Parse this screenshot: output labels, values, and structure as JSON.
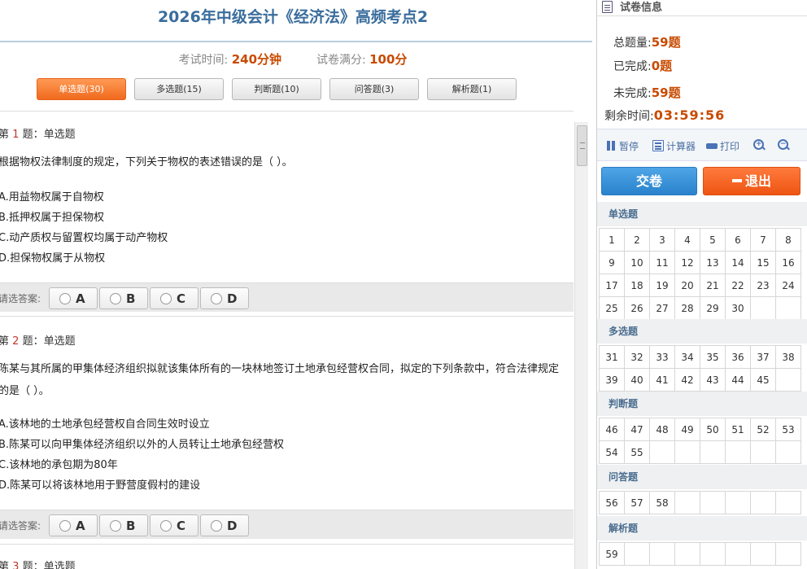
{
  "exam": {
    "title": "2026年中级会计《经济法》高频考点2",
    "time_label": "考试时间:",
    "time_value": "240分钟",
    "score_label": "试卷满分:",
    "score_value": "100分"
  },
  "tabs": [
    {
      "label": "单选题",
      "count": "(30)",
      "active": true
    },
    {
      "label": "多选题",
      "count": "(15)",
      "active": false
    },
    {
      "label": "判断题",
      "count": "(10)",
      "active": false
    },
    {
      "label": "问答题",
      "count": "(3)",
      "active": false
    },
    {
      "label": "解析题",
      "count": "(1)",
      "active": false
    }
  ],
  "questions": [
    {
      "prefix": "第",
      "num": "1",
      "suffix": "题：单选题",
      "text": "根据物权法律制度的规定，下列关于物权的表述错误的是（  ）。",
      "options": [
        "A.用益物权属于自物权",
        "B.抵押权属于担保物权",
        "C.动产质权与留置权均属于动产物权",
        "D.担保物权属于从物权"
      ]
    },
    {
      "prefix": "第",
      "num": "2",
      "suffix": "题：单选题",
      "text": "陈某与其所属的甲集体经济组织拟就该集体所有的一块林地签订土地承包经营权合同，拟定的下列条款中，符合法律规定的是（  ）。",
      "options": [
        "A.该林地的土地承包经营权自合同生效时设立",
        "B.陈某可以向甲集体经济组织以外的人员转让土地承包经营权",
        "C.该林地的承包期为80年",
        "D.陈某可以将该林地用于野营度假村的建设"
      ]
    },
    {
      "prefix": "第",
      "num": "3",
      "suffix": "题：单选题"
    }
  ],
  "answer_label": "请选答案:",
  "answer_choices": [
    "A",
    "B",
    "C",
    "D"
  ],
  "sidebar": {
    "header": "试卷信息",
    "total_label": "总题量:",
    "total_value": "59题",
    "done_label": "已完成:",
    "done_value": "0题",
    "undone_label": "未完成:",
    "undone_value": "59题",
    "timer_label": "剩余时间:",
    "timer_value": "03:59:56",
    "tools": {
      "pause": "暂停",
      "calculator": "计算器",
      "print": "打印"
    },
    "submit": "交卷",
    "exit": "退出",
    "sections": [
      {
        "title": "单选题",
        "rows": [
          [
            "1",
            "2",
            "3",
            "4",
            "5",
            "6",
            "7",
            "8"
          ],
          [
            "9",
            "10",
            "11",
            "12",
            "13",
            "14",
            "15",
            "16"
          ],
          [
            "17",
            "18",
            "19",
            "20",
            "21",
            "22",
            "23",
            "24"
          ],
          [
            "25",
            "26",
            "27",
            "28",
            "29",
            "30",
            "",
            ""
          ]
        ]
      },
      {
        "title": "多选题",
        "rows": [
          [
            "31",
            "32",
            "33",
            "34",
            "35",
            "36",
            "37",
            "38"
          ],
          [
            "39",
            "40",
            "41",
            "42",
            "43",
            "44",
            "45",
            ""
          ]
        ]
      },
      {
        "title": "判断题",
        "rows": [
          [
            "46",
            "47",
            "48",
            "49",
            "50",
            "51",
            "52",
            "53"
          ],
          [
            "54",
            "55",
            "",
            "",
            "",
            "",
            "",
            ""
          ]
        ]
      },
      {
        "title": "问答题",
        "rows": [
          [
            "56",
            "57",
            "58",
            "",
            "",
            "",
            "",
            ""
          ]
        ]
      },
      {
        "title": "解析题",
        "rows": [
          [
            "59",
            "",
            "",
            "",
            "",
            "",
            "",
            ""
          ]
        ]
      }
    ]
  },
  "colors": {
    "accent": "#f06a1d",
    "title": "#3a6d9c",
    "value": "#c84a00",
    "submit": "#2a82cc"
  }
}
